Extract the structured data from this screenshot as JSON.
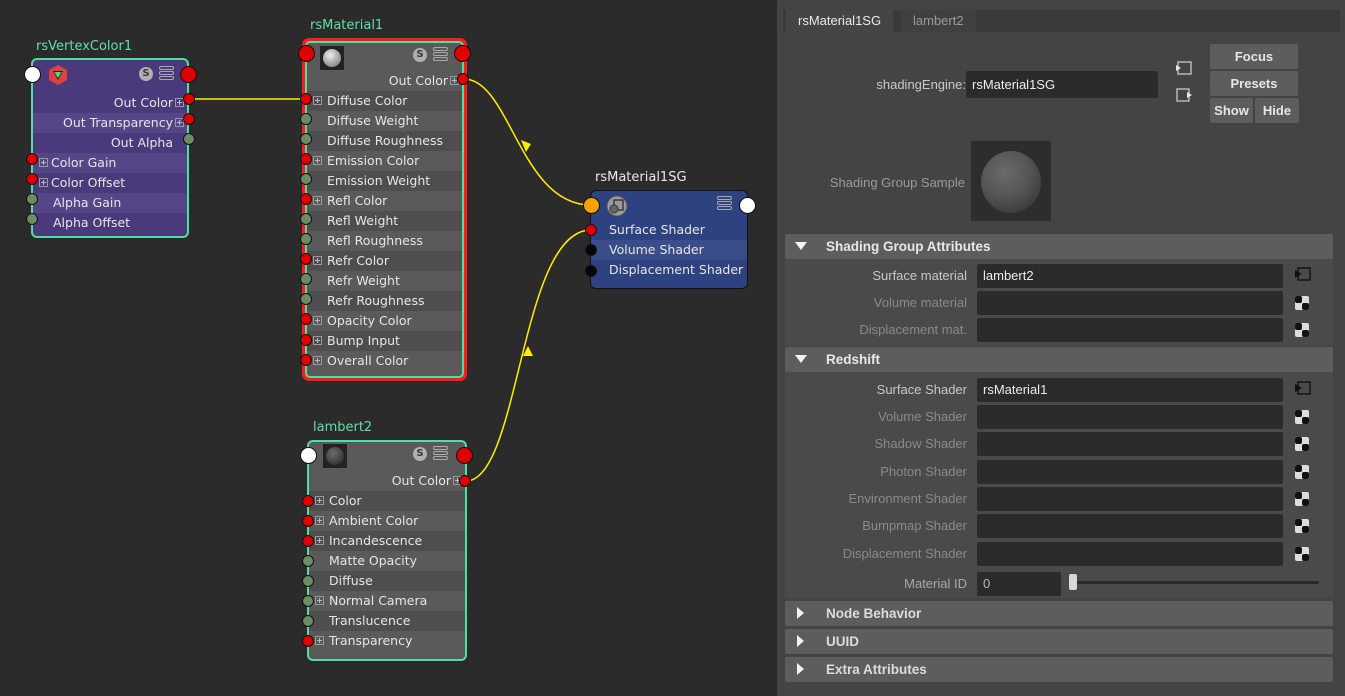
{
  "graph": {
    "nodes": {
      "vertex_color": {
        "title": "rsVertexColor1",
        "outputs": [
          "Out Color",
          "Out Transparency",
          "Out Alpha"
        ],
        "inputs": [
          "Color Gain",
          "Color Offset",
          "Alpha Gain",
          "Alpha Offset"
        ]
      },
      "rs_material": {
        "title": "rsMaterial1",
        "output": "Out Color",
        "inputs": [
          "Diffuse Color",
          "Diffuse Weight",
          "Diffuse Roughness",
          "Emission Color",
          "Emission Weight",
          "Refl Color",
          "Refl Weight",
          "Refl Roughness",
          "Refr Color",
          "Refr Weight",
          "Refr Roughness",
          "Opacity Color",
          "Bump Input",
          "Overall Color"
        ]
      },
      "lambert": {
        "title": "lambert2",
        "output": "Out Color",
        "inputs": [
          "Color",
          "Ambient Color",
          "Incandescence",
          "Matte Opacity",
          "Diffuse",
          "Normal Camera",
          "Translucence",
          "Transparency"
        ]
      },
      "shading_group": {
        "title": "rsMaterial1SG",
        "inputs": [
          "Surface Shader",
          "Volume Shader",
          "Displacement Shader"
        ]
      }
    },
    "node_header_icons": [
      "swatch-s-icon",
      "attribute-list-icon"
    ],
    "connections": [
      {
        "from": "rsVertexColor1.Out Color",
        "to": "rsMaterial1.Diffuse Color"
      },
      {
        "from": "rsMaterial1.Out Color",
        "to": "rsMaterial1SG.(message)"
      },
      {
        "from": "lambert2.Out Color",
        "to": "rsMaterial1SG.Surface Shader"
      }
    ],
    "colors": {
      "selected_outline": "#4fe0a0",
      "error_outline": "#ff1a1a",
      "wire": "#ffee00",
      "vertex_node_bg": "#4a3a7c",
      "material_node_bg": "#5a5a5a",
      "sg_node_bg": "#2e4180"
    }
  },
  "attribute_editor": {
    "tabs": [
      {
        "label": "rsMaterial1SG",
        "active": true
      },
      {
        "label": "lambert2",
        "active": false
      }
    ],
    "shading_engine_label": "shadingEngine:",
    "shading_engine_value": "rsMaterial1SG",
    "buttons": {
      "focus": "Focus",
      "presets": "Presets",
      "show": "Show",
      "hide": "Hide"
    },
    "sample_label": "Shading Group Sample",
    "sections": {
      "shading_group_attributes": {
        "title": "Shading Group Attributes",
        "expanded": true,
        "fields": [
          {
            "label": "Surface material",
            "value": "lambert2",
            "enabled": true
          },
          {
            "label": "Volume material",
            "value": "",
            "enabled": false
          },
          {
            "label": "Displacement mat.",
            "value": "",
            "enabled": false
          }
        ]
      },
      "redshift": {
        "title": "Redshift",
        "expanded": true,
        "fields": [
          {
            "label": "Surface Shader",
            "value": "rsMaterial1",
            "enabled": true
          },
          {
            "label": "Volume Shader",
            "value": "",
            "enabled": false
          },
          {
            "label": "Shadow Shader",
            "value": "",
            "enabled": false
          },
          {
            "label": "Photon Shader",
            "value": "",
            "enabled": false
          },
          {
            "label": "Environment Shader",
            "value": "",
            "enabled": false
          },
          {
            "label": "Bumpmap Shader",
            "value": "",
            "enabled": false
          },
          {
            "label": "Displacement Shader",
            "value": "",
            "enabled": false
          }
        ],
        "material_id": {
          "label": "Material ID",
          "value": "0",
          "slider_fraction": 0.0
        }
      },
      "node_behavior": {
        "title": "Node Behavior",
        "expanded": false
      },
      "uuid": {
        "title": "UUID",
        "expanded": false
      },
      "extra_attributes": {
        "title": "Extra Attributes",
        "expanded": false
      }
    }
  }
}
